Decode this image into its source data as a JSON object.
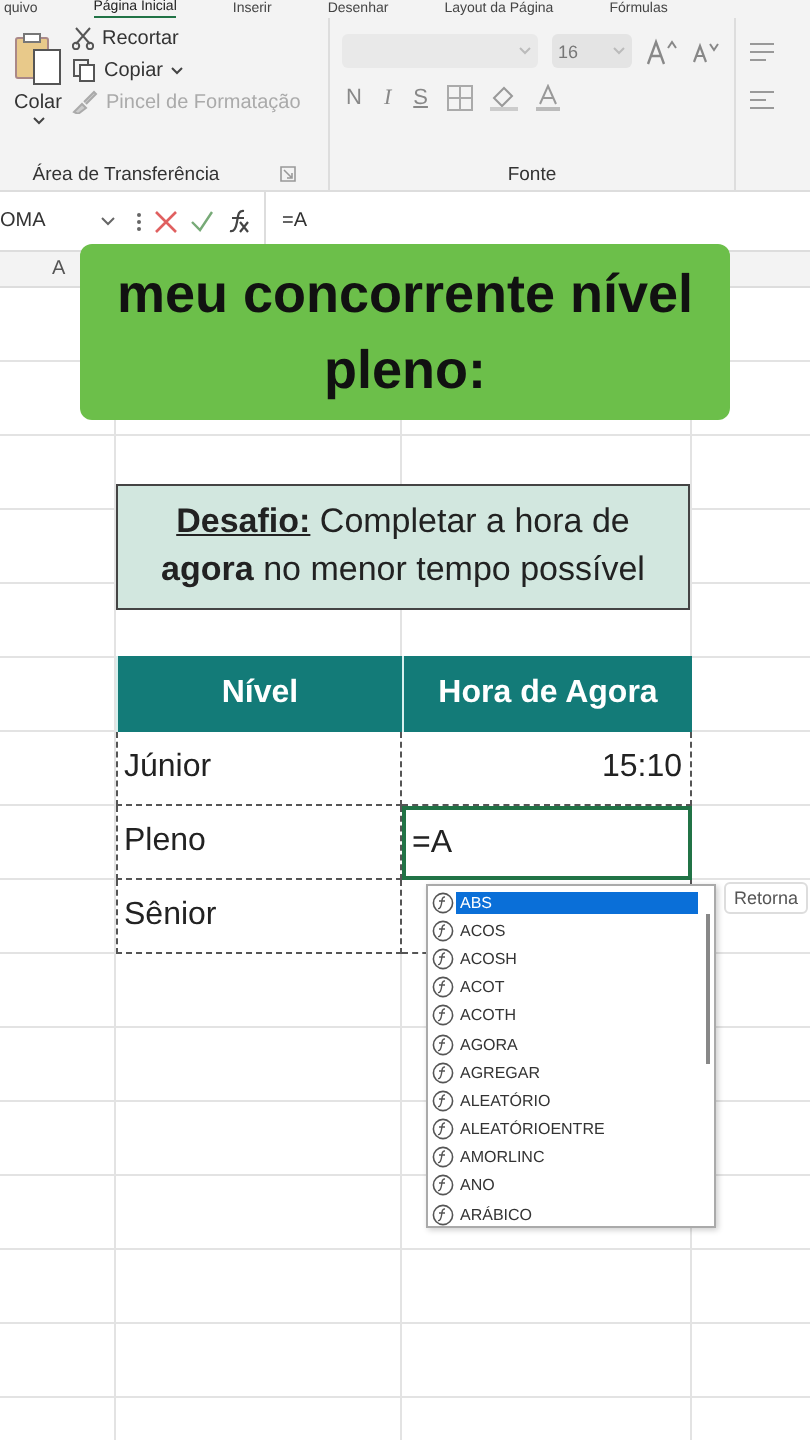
{
  "ribbon_tabs": [
    {
      "label": "quivo",
      "selected": false
    },
    {
      "label": "Página Inicial",
      "selected": true
    },
    {
      "label": "Inserir",
      "selected": false
    },
    {
      "label": "Desenhar",
      "selected": false
    },
    {
      "label": "Layout da Página",
      "selected": false
    },
    {
      "label": "Fórmulas",
      "selected": false
    }
  ],
  "clipboard": {
    "paste": "Colar",
    "items": [
      {
        "kind": "cut",
        "label": "Recortar",
        "disabled": false
      },
      {
        "kind": "copy",
        "label": "Copiar",
        "disabled": false
      },
      {
        "kind": "brush",
        "label": "Pincel de Formatação",
        "disabled": true
      }
    ],
    "group_label": "Área de Transferência"
  },
  "font": {
    "size": "16",
    "disabled": true,
    "styles": [
      "N",
      "I",
      "S"
    ],
    "group_label": "Fonte"
  },
  "formula_bar": {
    "name_box": "OMA",
    "formula": "=A"
  },
  "column_header": "A",
  "caption": [
    "meu concorrente nível",
    "pleno:"
  ],
  "challenge": "**Desafio:** Completar a hora de **agora** no menor tempo possível",
  "table": {
    "columns": [
      "Nível",
      "Hora de Agora"
    ],
    "rows": [
      {
        "level": "Júnior",
        "time": "15:10",
        "editing": false
      },
      {
        "level": "Pleno",
        "time": "=A",
        "editing": true
      },
      {
        "level": "Sênior",
        "editing": false
      }
    ]
  },
  "autocomplete": [
    {
      "label": "ABS",
      "selected": true
    },
    {
      "label": "ACOS",
      "selected": false
    },
    {
      "label": "ACOSH",
      "selected": false
    },
    {
      "label": "ACOT",
      "selected": false
    },
    {
      "label": "ACOTH",
      "selected": false
    },
    {
      "label": "AGORA",
      "selected": false
    },
    {
      "label": "AGREGAR",
      "selected": false
    },
    {
      "label": "ALEATÓRIO",
      "selected": false
    },
    {
      "label": "ALEATÓRIOENTRE",
      "selected": false
    },
    {
      "label": "AMORLINC",
      "selected": false
    },
    {
      "label": "ANO",
      "selected": false
    },
    {
      "label": "ARÁBICO",
      "selected": false
    }
  ],
  "tooltip": "Retorna"
}
